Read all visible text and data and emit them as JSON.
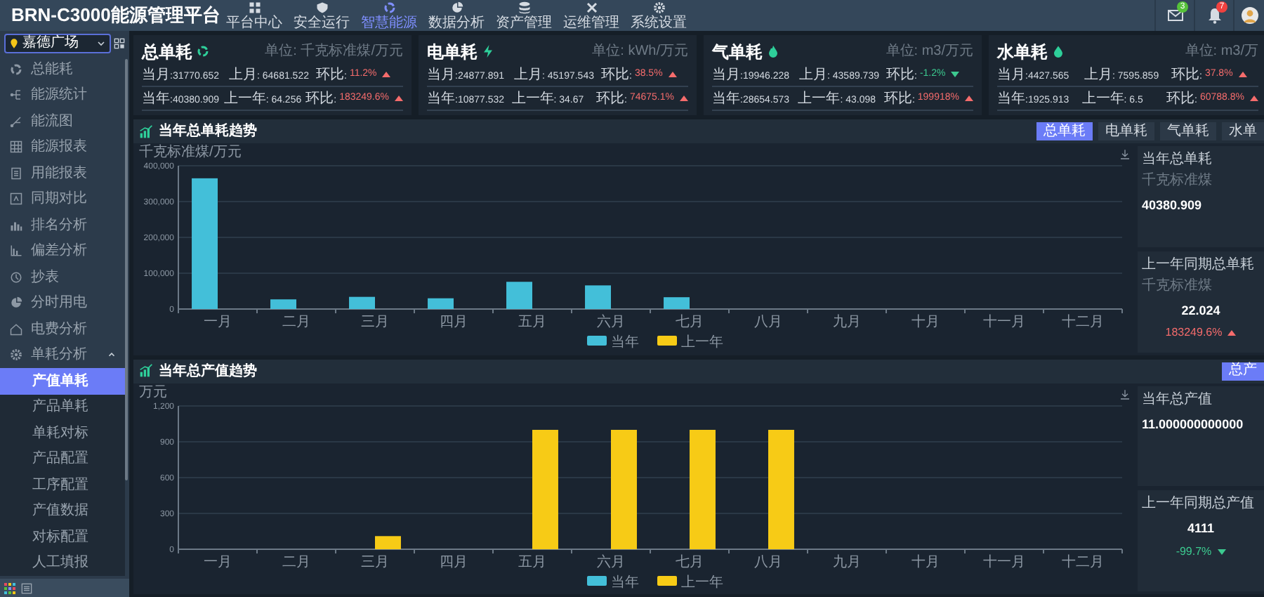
{
  "header": {
    "title": "BRN-C3000能源管理平台",
    "nav": [
      {
        "label": "平台中心",
        "selected": false
      },
      {
        "label": "安全运行",
        "selected": false
      },
      {
        "label": "智慧能源",
        "selected": true
      },
      {
        "label": "数据分析",
        "selected": false
      },
      {
        "label": "资产管理",
        "selected": false
      },
      {
        "label": "运维管理",
        "selected": false
      },
      {
        "label": "系统设置",
        "selected": false
      }
    ],
    "mail_badge": "3",
    "bell_badge": "7"
  },
  "sidebar": {
    "site": "嘉德广场",
    "items": [
      {
        "label": "总能耗",
        "selected": false
      },
      {
        "label": "能源统计",
        "selected": false
      },
      {
        "label": "能流图",
        "selected": false
      },
      {
        "label": "能源报表",
        "selected": false
      },
      {
        "label": "用能报表",
        "selected": false
      },
      {
        "label": "同期对比",
        "selected": false
      },
      {
        "label": "排名分析",
        "selected": false
      },
      {
        "label": "偏差分析",
        "selected": false
      },
      {
        "label": "抄表",
        "selected": false
      },
      {
        "label": "分时用电",
        "selected": false
      },
      {
        "label": "电费分析",
        "selected": false
      },
      {
        "label": "单耗分析",
        "selected": false,
        "expanded": true,
        "children": [
          {
            "label": "产值单耗",
            "selected": true
          },
          {
            "label": "产品单耗",
            "selected": false
          },
          {
            "label": "单耗对标",
            "selected": false
          },
          {
            "label": "产品配置",
            "selected": false
          },
          {
            "label": "工序配置",
            "selected": false
          },
          {
            "label": "产值数据",
            "selected": false
          },
          {
            "label": "对标配置",
            "selected": false
          },
          {
            "label": "人工填报",
            "selected": false
          }
        ]
      }
    ]
  },
  "cards": [
    {
      "title": "总单耗",
      "unit": "单位: 千克标准煤/万元",
      "rows": [
        {
          "current": "当月:31770.652",
          "previous": "上月: 64681.522",
          "change_label": "环比:",
          "change": "11.2%",
          "rising": true
        },
        {
          "current": "当年:40380.909",
          "previous": "上一年: 64.256",
          "change_label": "环比:",
          "change": "183249.6%",
          "rising": true
        }
      ]
    },
    {
      "title": "电单耗",
      "unit": "单位: kWh/万元",
      "rows": [
        {
          "current": "当月:24877.891",
          "previous": "上月: 45197.543",
          "change_label": "环比:",
          "change": "38.5%",
          "rising": true
        },
        {
          "current": "当年:10877.532",
          "previous": "上一年: 34.67",
          "change_label": "环比:",
          "change": "74675.1%",
          "rising": true
        }
      ]
    },
    {
      "title": "气单耗",
      "unit": "单位: m3/万元",
      "rows": [
        {
          "current": "当月:19946.228",
          "previous": "上月: 43589.739",
          "change_label": "环比:",
          "change": "-1.2%",
          "rising": false
        },
        {
          "current": "当年:28654.573",
          "previous": "上一年: 43.098",
          "change_label": "环比:",
          "change": "199918%",
          "rising": true
        }
      ]
    },
    {
      "title": "水单耗",
      "unit": "单位: m3/万",
      "rows": [
        {
          "current": "当月:4427.565",
          "previous": "上月: 7595.859",
          "change_label": "环比:",
          "change": "37.8%",
          "rising": true
        },
        {
          "current": "当年:1925.913",
          "previous": "上一年: 6.5",
          "change_label": "环比:",
          "change": "60788.8%",
          "rising": true
        }
      ]
    }
  ],
  "panels": [
    {
      "title": "当年总单耗趋势",
      "tabs": [
        {
          "label": "总单耗",
          "selected": true
        },
        {
          "label": "电单耗",
          "selected": false
        },
        {
          "label": "气单耗",
          "selected": false
        },
        {
          "label": "水单",
          "selected": false
        }
      ],
      "chart_data": {
        "type": "bar",
        "ylabel": "千克标准煤/万元",
        "categories": [
          "一月",
          "二月",
          "三月",
          "四月",
          "五月",
          "六月",
          "七月",
          "八月",
          "九月",
          "十月",
          "十一月",
          "十二月"
        ],
        "series": [
          {
            "name": "当年",
            "color": "#43bfd9",
            "values": [
              365000,
              27000,
              34000,
              30000,
              76000,
              66000,
              33000,
              0,
              0,
              0,
              0,
              0
            ]
          },
          {
            "name": "上一年",
            "color": "#f7cb16",
            "values": [
              0,
              0,
              0,
              0,
              0,
              0,
              0,
              0,
              0,
              0,
              0,
              0
            ]
          }
        ],
        "ylim": [
          0,
          400000
        ],
        "grid": true,
        "yticks": [
          {
            "value": 0,
            "label": "0"
          },
          {
            "value": 100000,
            "label": "100,000"
          },
          {
            "value": 200000,
            "label": "200,000"
          },
          {
            "value": 300000,
            "label": "300,000"
          },
          {
            "value": 400000,
            "label": "400,000"
          }
        ]
      },
      "summary": [
        {
          "title": "当年总单耗",
          "unit": "千克标准煤",
          "value": "40380.909"
        },
        {
          "title": "上一年同期总单耗",
          "unit": "千克标准煤",
          "value": "22.024",
          "change": "183249.6%",
          "rising": true
        }
      ]
    },
    {
      "title": "当年总产值趋势",
      "tabs": [
        {
          "label": "总产",
          "selected": true
        }
      ],
      "chart_data": {
        "type": "bar",
        "ylabel": "万元",
        "categories": [
          "一月",
          "二月",
          "三月",
          "四月",
          "五月",
          "六月",
          "七月",
          "八月",
          "九月",
          "十月",
          "十一月",
          "十二月"
        ],
        "series": [
          {
            "name": "当年",
            "color": "#43bfd9",
            "values": [
              0,
              0,
              0,
              0,
              0,
              0,
              0,
              0,
              0,
              0,
              0,
              0
            ]
          },
          {
            "name": "上一年",
            "color": "#f7cb16",
            "values": [
              0,
              0,
              110,
              0,
              1000,
              1000,
              1000,
              1000,
              0,
              0,
              0,
              0
            ]
          }
        ],
        "ylim": [
          0,
          1200
        ],
        "grid": true,
        "yticks": [
          {
            "value": 0,
            "label": "0"
          },
          {
            "value": 300,
            "label": "300"
          },
          {
            "value": 600,
            "label": "600"
          },
          {
            "value": 900,
            "label": "900"
          },
          {
            "value": 1200,
            "label": "1,200"
          }
        ]
      },
      "summary": [
        {
          "title": "当年总产值",
          "value": "11.000000000000"
        },
        {
          "title": "上一年同期总产值",
          "value": "4111",
          "change": "-99.7%",
          "rising": false
        }
      ]
    }
  ]
}
